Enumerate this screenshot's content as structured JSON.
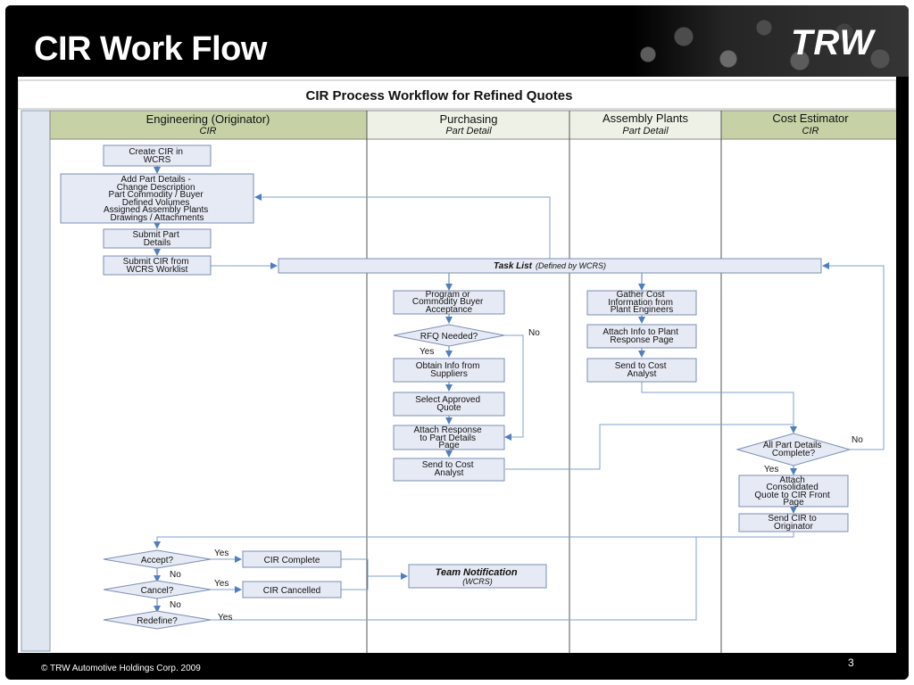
{
  "slide": {
    "title": "CIR Work Flow",
    "logo": "TRW",
    "footer": "© TRW Automotive Holdings Corp. 2009",
    "page_number": "3"
  },
  "diagram": {
    "header": "CIR Process Workflow for Refined Quotes",
    "lanes": [
      {
        "title": "Engineering (Originator)",
        "subtitle": "CIR"
      },
      {
        "title": "Purchasing",
        "subtitle": "Part Detail"
      },
      {
        "title": "Assembly Plants",
        "subtitle": "Part Detail"
      },
      {
        "title": "Cost Estimator",
        "subtitle": "CIR"
      }
    ],
    "engineering": {
      "create": [
        "Create CIR in",
        "WCRS"
      ],
      "add_details": [
        "Add Part Details -",
        "Change Description",
        "Part Commodity / Buyer",
        "Defined Volumes",
        "Assigned Assembly Plants",
        "Drawings / Attachments"
      ],
      "submit_details": [
        "Submit Part",
        "Details"
      ],
      "submit_cir": [
        "Submit CIR from",
        "WCRS Worklist"
      ],
      "accept": "Accept?",
      "cancel": "Cancel?",
      "redefine": "Redefine?",
      "cir_complete": "CIR Complete",
      "cir_cancelled": "CIR Cancelled"
    },
    "task_list": {
      "bold": "Task List",
      "italic": "(Defined by WCRS)"
    },
    "purchasing": {
      "program": [
        "Program or",
        "Commodity Buyer",
        "Acceptance"
      ],
      "rfq": "RFQ Needed?",
      "obtain": [
        "Obtain Info from",
        "Suppliers"
      ],
      "select": [
        "Select Approved",
        "Quote"
      ],
      "attach": [
        "Attach Response",
        "to Part Details",
        "Page"
      ],
      "send": [
        "Send to Cost",
        "Analyst"
      ]
    },
    "assembly": {
      "gather": [
        "Gather Cost",
        "Information from",
        "Plant Engineers"
      ],
      "attach": [
        "Attach Info to Plant",
        "Response Page"
      ],
      "send": [
        "Send to Cost",
        "Analyst"
      ]
    },
    "cost": {
      "all_complete": [
        "All Part Details",
        "Complete?"
      ],
      "attach": [
        "Attach",
        "Consolidated",
        "Quote to CIR Front",
        "Page"
      ],
      "send": [
        "Send CIR to",
        "Originator"
      ]
    },
    "team_notification": {
      "bold": "Team Notification",
      "italic": "(WCRS)"
    },
    "labels": {
      "yes": "Yes",
      "no": "No"
    }
  }
}
